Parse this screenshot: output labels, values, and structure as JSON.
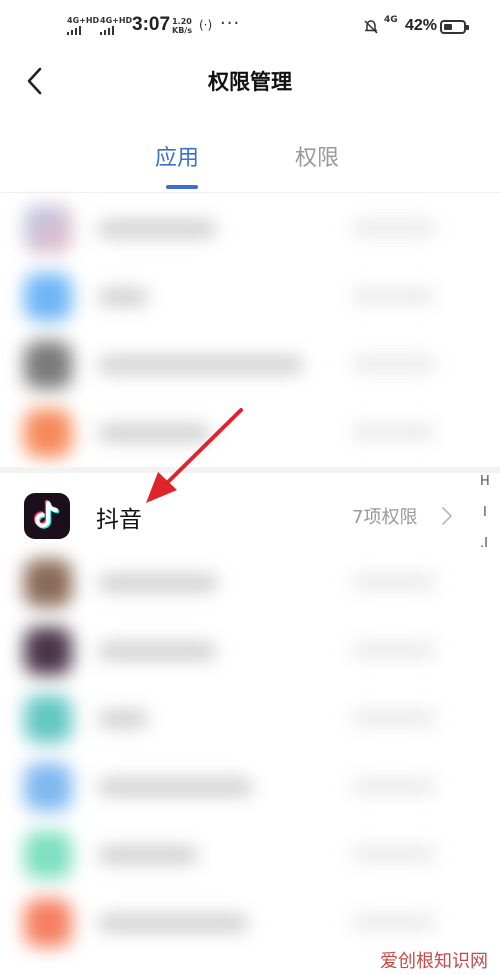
{
  "status_bar": {
    "sim1": "4G+HD",
    "sim2": "4G+HD",
    "time": "3:07",
    "speed_value": "1.20",
    "speed_unit": "KB/s",
    "network": "4G",
    "battery_percent": "42%",
    "battery_level": 0.42
  },
  "header": {
    "title": "权限管理"
  },
  "tabs": [
    {
      "label": "应用",
      "active": true
    },
    {
      "label": "权限",
      "active": false
    }
  ],
  "app_list": {
    "highlighted": {
      "name": "抖音",
      "permission_count": "7项权限"
    }
  },
  "index_bar": [
    "H",
    "I",
    ".I"
  ],
  "watermark": "爱创根知识网",
  "colors": {
    "accent": "#3d6fd0",
    "arrow": "#e0242b"
  }
}
